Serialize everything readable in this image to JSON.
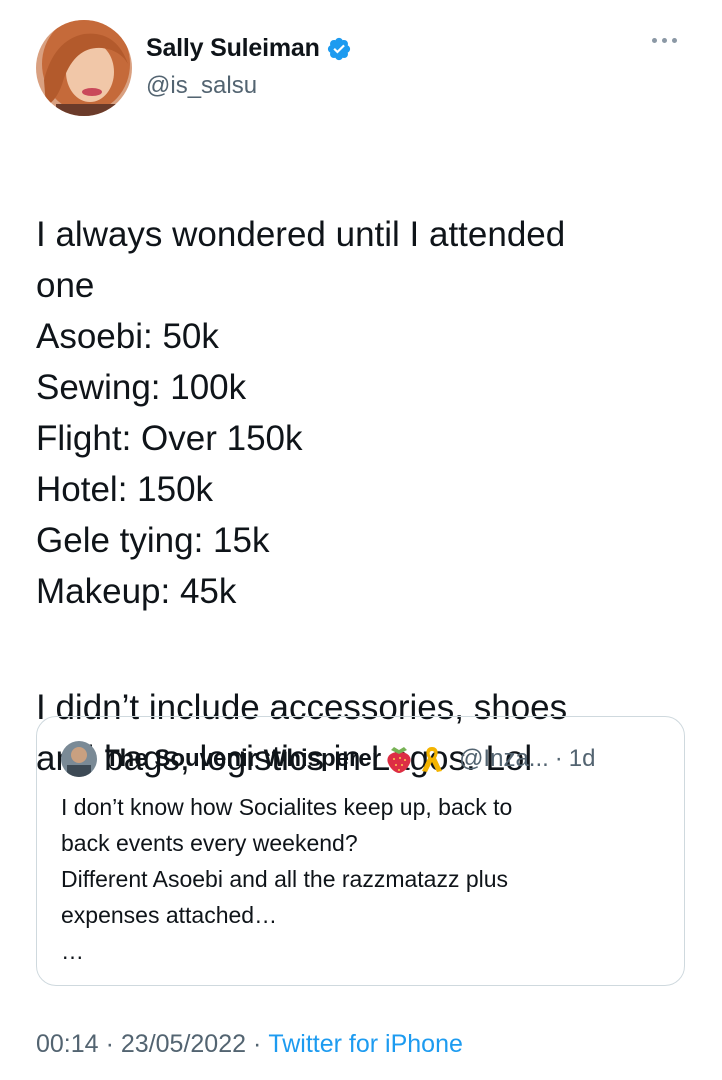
{
  "author": {
    "name": "Sally Suleiman",
    "handle": "@is_salsu",
    "verified": true
  },
  "tweet": {
    "text": "I always wondered until I attended\none\nAsoebi: 50k\nSewing: 100k\nFlight: Over 150k\nHotel: 150k\nGele tying: 15k\nMakeup: 45k",
    "text_2": "I didn’t include accessories, shoes\nand bags, logistics in Lagos. Lol"
  },
  "quote": {
    "name": "The Souvenir Whisperer",
    "emojis": [
      "strawberry-icon",
      "yellow-ribbon-icon"
    ],
    "handle": "@Inza...",
    "separator": "·",
    "time": "1d",
    "text": "I don’t know how Socialites keep up, back to\nback events every weekend?\nDifferent Asoebi and all the razzmatazz plus\nexpenses attached…\n…"
  },
  "footer": {
    "time": "00:14",
    "date": "23/05/2022",
    "separator": "·",
    "source": "Twitter for iPhone"
  },
  "colors": {
    "accent": "#1d9bf0",
    "secondary_text": "#536471",
    "border": "#cfd9de"
  }
}
